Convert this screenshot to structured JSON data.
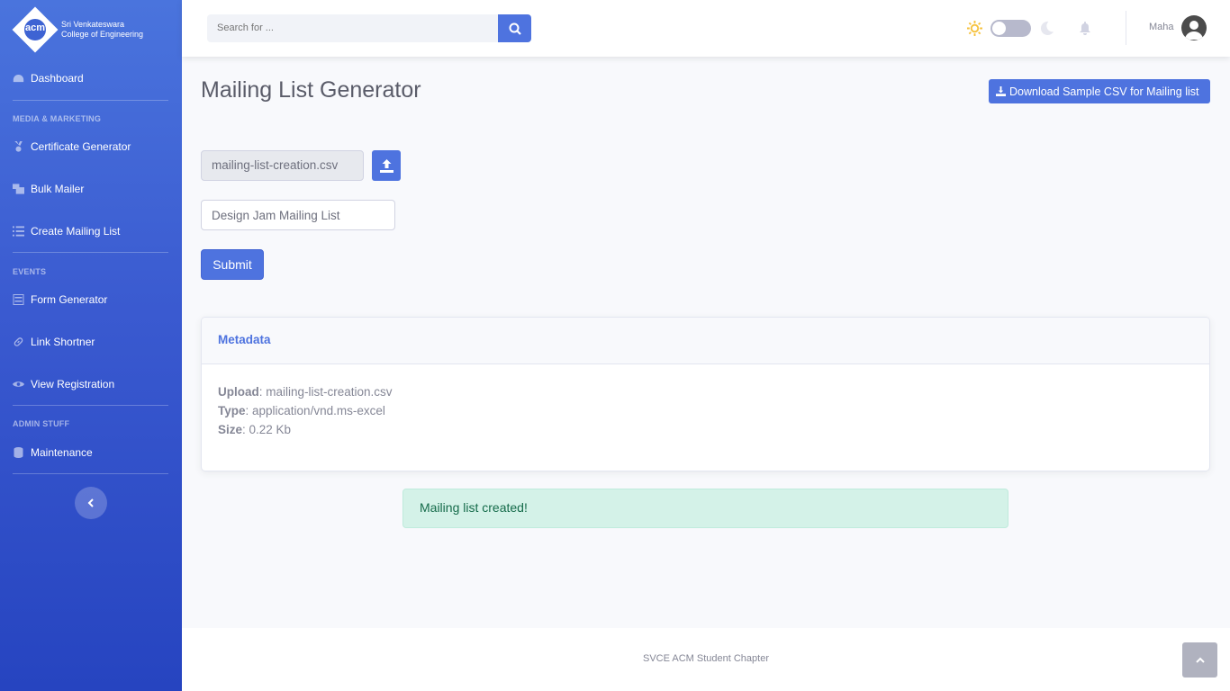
{
  "brand": {
    "logo_text": "acm",
    "line1": "Sri Venkateswara",
    "line2": "College of Engineering"
  },
  "sidebar": {
    "dashboard": "Dashboard",
    "heading_media": "MEDIA & MARKETING",
    "certificate": "Certificate Generator",
    "bulk_mailer": "Bulk Mailer",
    "create_list": "Create Mailing List",
    "heading_events": "EVENTS",
    "form_generator": "Form Generator",
    "link_shortner": "Link Shortner",
    "view_registration": "View Registration",
    "heading_admin": "ADMIN STUFF",
    "maintenance": "Maintenance"
  },
  "topbar": {
    "search_placeholder": "Search for ...",
    "username": "Maha"
  },
  "main": {
    "title": "Mailing List Generator",
    "download_label": "Download Sample CSV for Mailing list",
    "file_name": "mailing-list-creation.csv",
    "list_name_value": "Design Jam Mailing List",
    "submit_label": "Submit"
  },
  "metadata": {
    "header": "Metadata",
    "upload_label": "Upload",
    "upload_value": ": mailing-list-creation.csv",
    "type_label": "Type",
    "type_value": ": application/vnd.ms-excel",
    "size_label": "Size",
    "size_value": ": 0.22 Kb"
  },
  "alert": "Mailing list created!",
  "footer": "SVCE ACM Student Chapter",
  "colors": {
    "primary": "#4e73df",
    "success_bg": "#d4f2e8",
    "sun": "#f6c23e"
  }
}
